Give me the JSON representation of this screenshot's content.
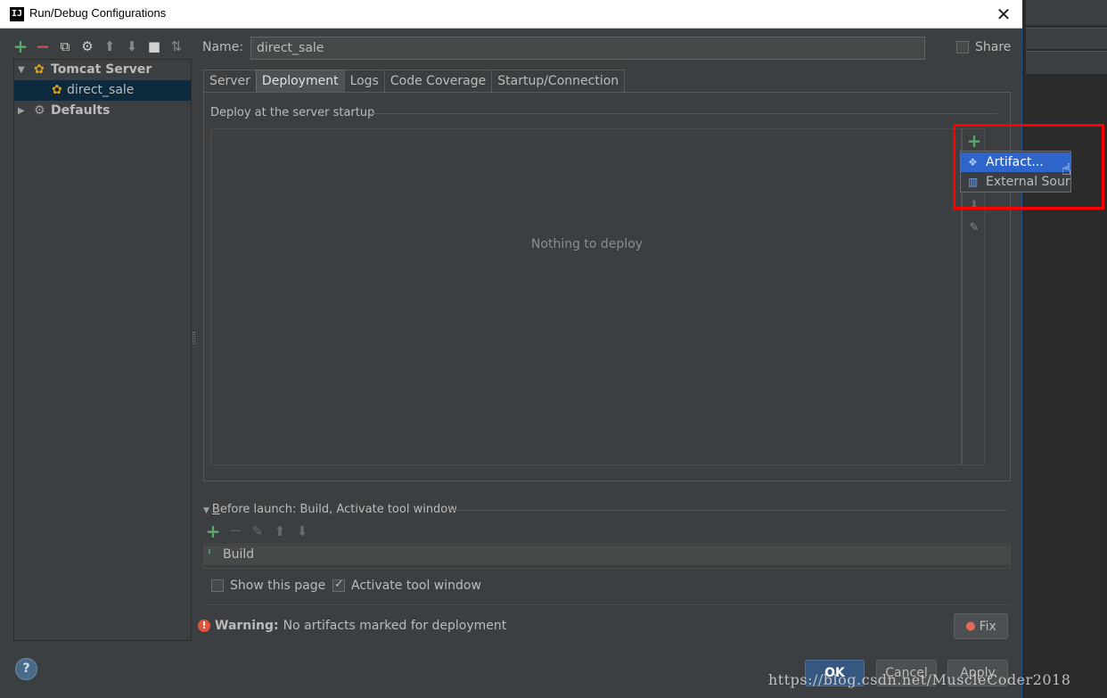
{
  "window": {
    "title": "Run/Debug Configurations",
    "app_icon": "IJ",
    "close_glyph": "✕"
  },
  "left_toolbar": {
    "icons": [
      "add-icon",
      "remove-icon",
      "copy-icon",
      "wrench-icon",
      "move-up-icon",
      "move-down-icon",
      "folder-icon",
      "sort-icon"
    ]
  },
  "tree": {
    "items": [
      {
        "label": "Tomcat Server",
        "expanded": true,
        "bold": true
      },
      {
        "label": "direct_sale",
        "selected": true
      },
      {
        "label": "Defaults",
        "expanded": false,
        "bold": true
      }
    ]
  },
  "name_field": {
    "label": "Name:",
    "value": "direct_sale"
  },
  "share": {
    "label": "Share",
    "checked": false
  },
  "tabs": [
    {
      "label": "Server",
      "active": false
    },
    {
      "label": "Deployment",
      "active": true
    },
    {
      "label": "Logs",
      "active": false
    },
    {
      "label": "Code Coverage",
      "active": false
    },
    {
      "label": "Startup/Connection",
      "active": false
    }
  ],
  "deploy": {
    "section_title": "Deploy at the server startup",
    "empty_text": "Nothing to deploy"
  },
  "popup_menu": {
    "items": [
      {
        "label": "Artifact...",
        "highlighted": true
      },
      {
        "label": "External Source..."
      }
    ]
  },
  "before_launch": {
    "title_prefix": "B",
    "title_rest": "efore launch: Build, Activate tool window",
    "tasks": [
      {
        "label": "Build"
      }
    ]
  },
  "options": {
    "show_page": {
      "label": "Show this page",
      "checked": false
    },
    "activate_tool_window": {
      "label": "Activate tool window",
      "checked": true
    }
  },
  "warning": {
    "prefix": "Warning:",
    "message": "No artifacts marked for deployment"
  },
  "buttons": {
    "fix": "Fix",
    "help": "?",
    "ok": "OK",
    "cancel": "Cancel",
    "apply": "Apply"
  },
  "watermark": "https://blog.csdn.net/MuscleCoder2018",
  "colors": {
    "background": "#3c3f41",
    "selection": "#0d293e",
    "menu_highlight": "#2f65ca",
    "accent_green": "#59a869",
    "accent_red": "#c75450",
    "annotation_red": "#ff0000",
    "ok_button": "#365880"
  }
}
